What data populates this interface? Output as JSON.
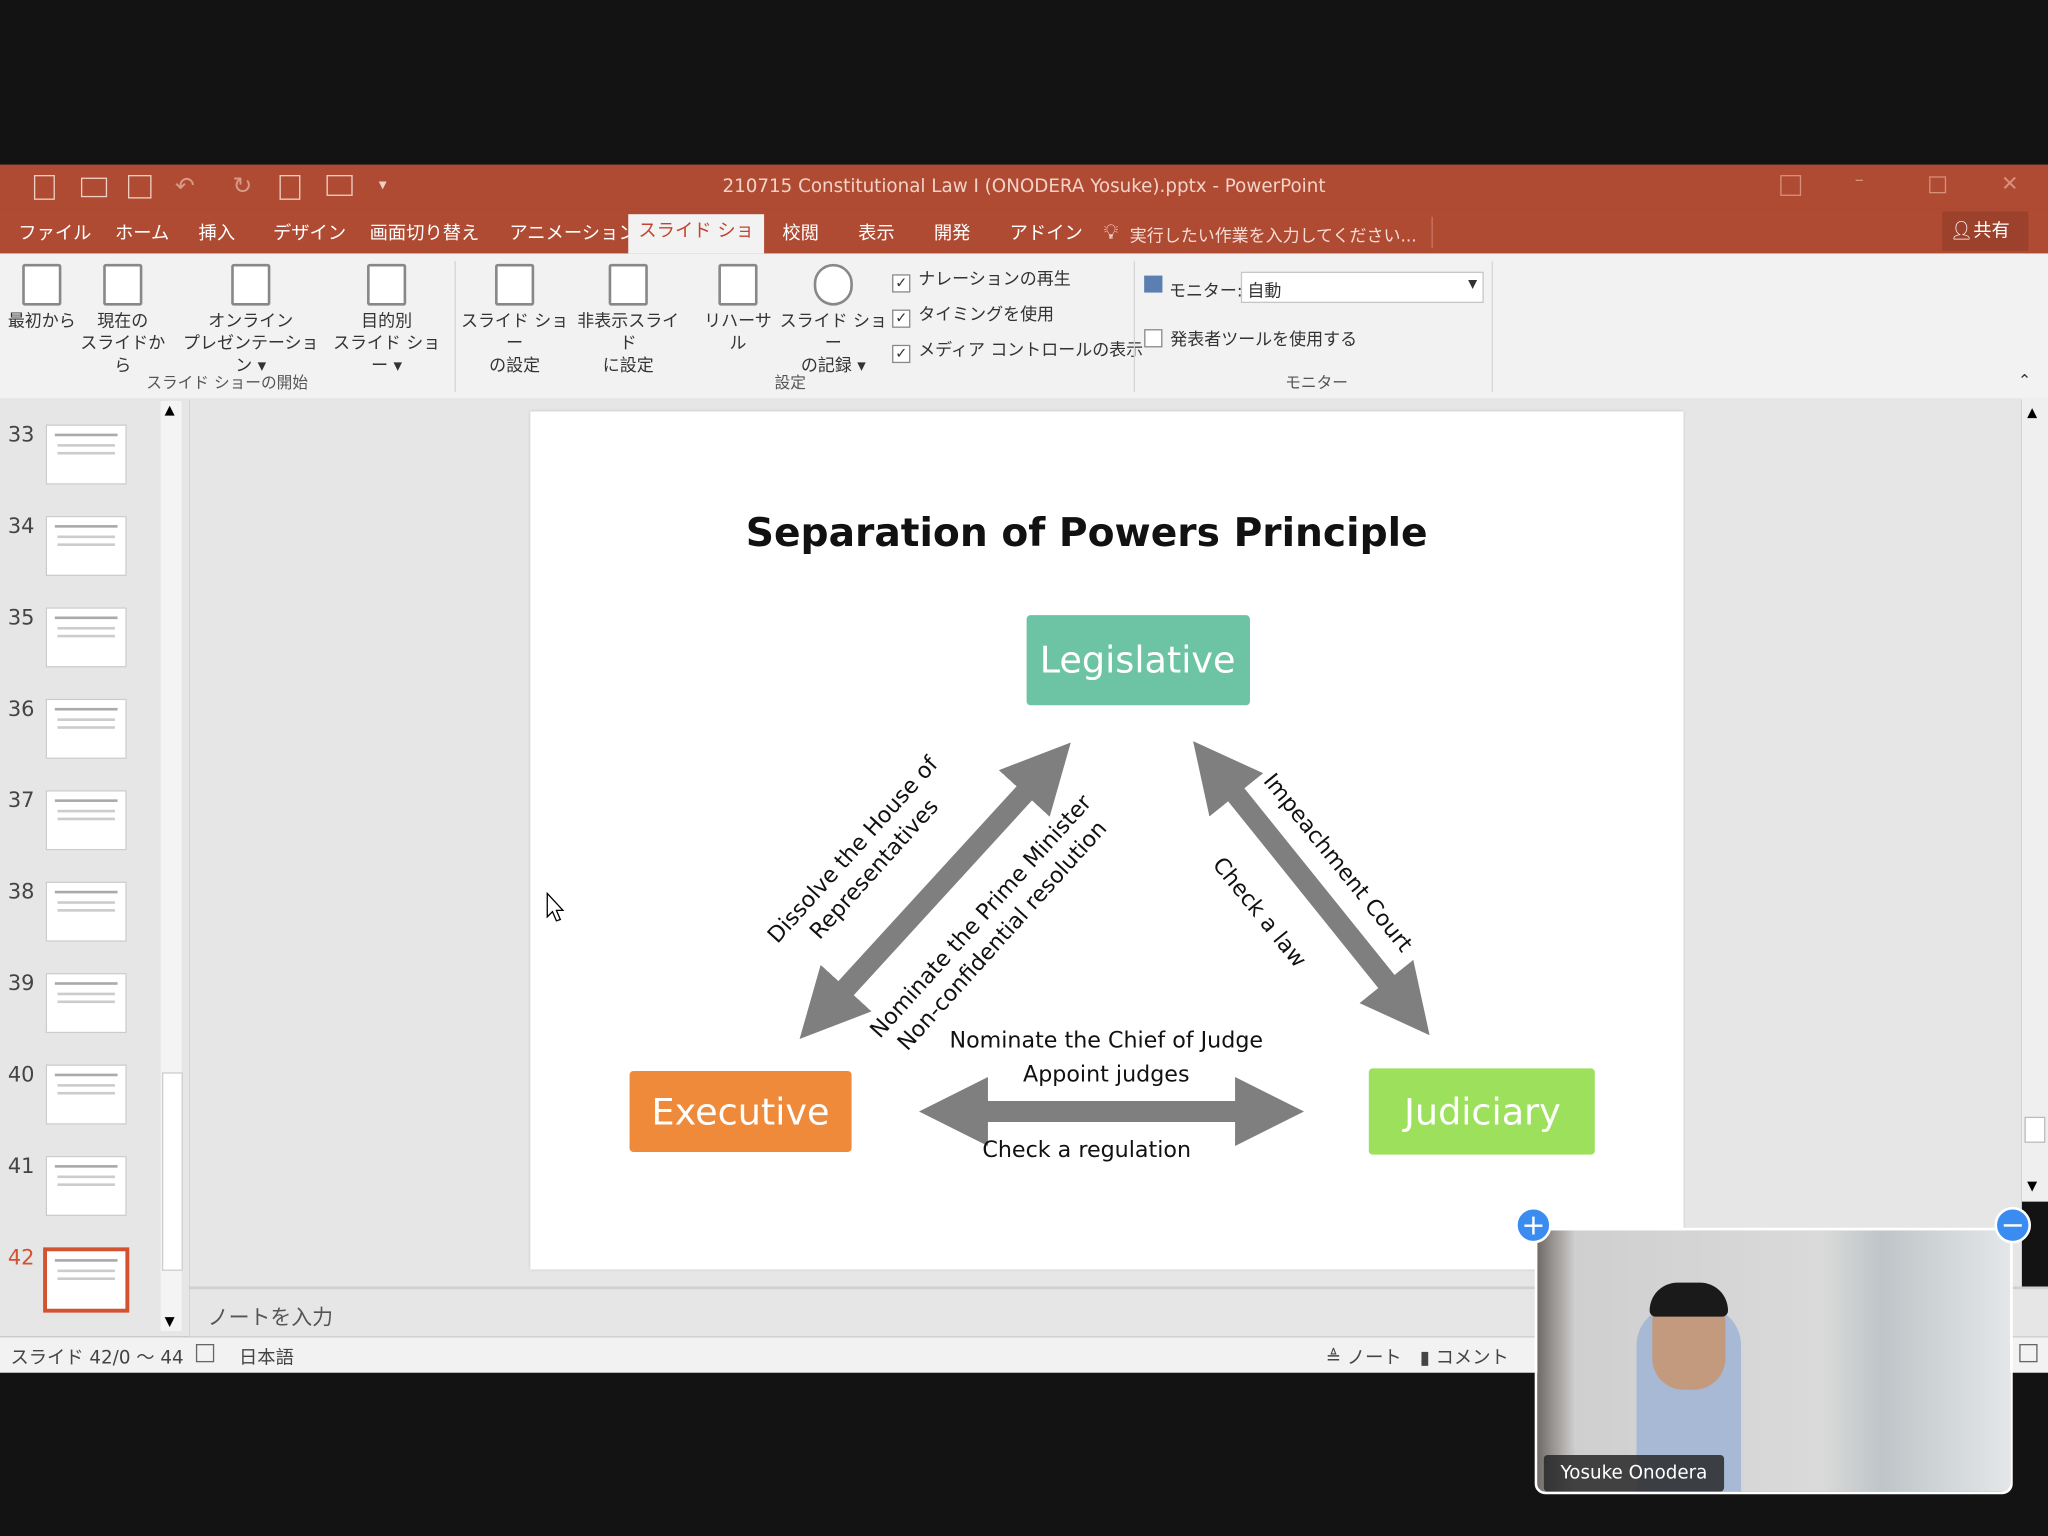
{
  "window": {
    "title": "210715 Constitutional Law I (ONODERA Yosuke).pptx - PowerPoint",
    "share": "共有",
    "tell_me": "実行したい作業を入力してください..."
  },
  "tabs": [
    "ファイル",
    "ホーム",
    "挿入",
    "デザイン",
    "画面切り替え",
    "アニメーション",
    "スライド ショー",
    "校閲",
    "表示",
    "開発",
    "アドイン"
  ],
  "active_tab": "スライド ショー",
  "ribbon": {
    "start": {
      "from_beginning": "最初から",
      "from_current_1": "現在の",
      "from_current_2": "スライドから",
      "online_1": "オンライン",
      "online_2": "プレゼンテーション ▾",
      "custom_1": "目的別",
      "custom_2": "スライド ショー ▾",
      "group": "スライド ショーの開始"
    },
    "setup": {
      "setup_1": "スライド ショー",
      "setup_2": "の設定",
      "hide_1": "非表示スライド",
      "hide_2": "に設定",
      "rehearse": "リハーサル",
      "record_1": "スライド ショー",
      "record_2": "の記録 ▾",
      "narration": "ナレーションの再生",
      "timing": "タイミングを使用",
      "media": "メディア コントロールの表示",
      "group": "設定"
    },
    "monitor": {
      "label": "モニター:",
      "value": "自動",
      "presenter": "発表者ツールを使用する",
      "group": "モニター"
    }
  },
  "slides": {
    "numbers": [
      "33",
      "34",
      "35",
      "36",
      "37",
      "38",
      "39",
      "40",
      "41",
      "42"
    ],
    "selected": "42"
  },
  "slide": {
    "title": "Separation of Powers Principle",
    "legislative": "Legislative",
    "executive": "Executive",
    "judiciary": "Judiciary",
    "dissolve_1": "Dissolve the House of",
    "dissolve_2": "Representatives",
    "nominate_pm": "Nominate the Prime Minister",
    "nonconf": "Non-confidential resolution",
    "impeach": "Impeachment Court",
    "check_law": "Check a law",
    "chief": "Nominate the Chief of Judge",
    "appoint": "Appoint judges",
    "check_reg": "Check a regulation",
    "colors": {
      "legislative": "#6cc4a4",
      "executive": "#ef8a3a",
      "judiciary": "#9de05c",
      "arrow": "#7f7f7f"
    }
  },
  "notes": {
    "placeholder": "ノートを入力"
  },
  "status": {
    "slide": "スライド 42/0 ～ 44",
    "lang": "日本語",
    "notes": "ノート",
    "comments": "コメント"
  },
  "video": {
    "name": "Yosuke Onodera"
  }
}
